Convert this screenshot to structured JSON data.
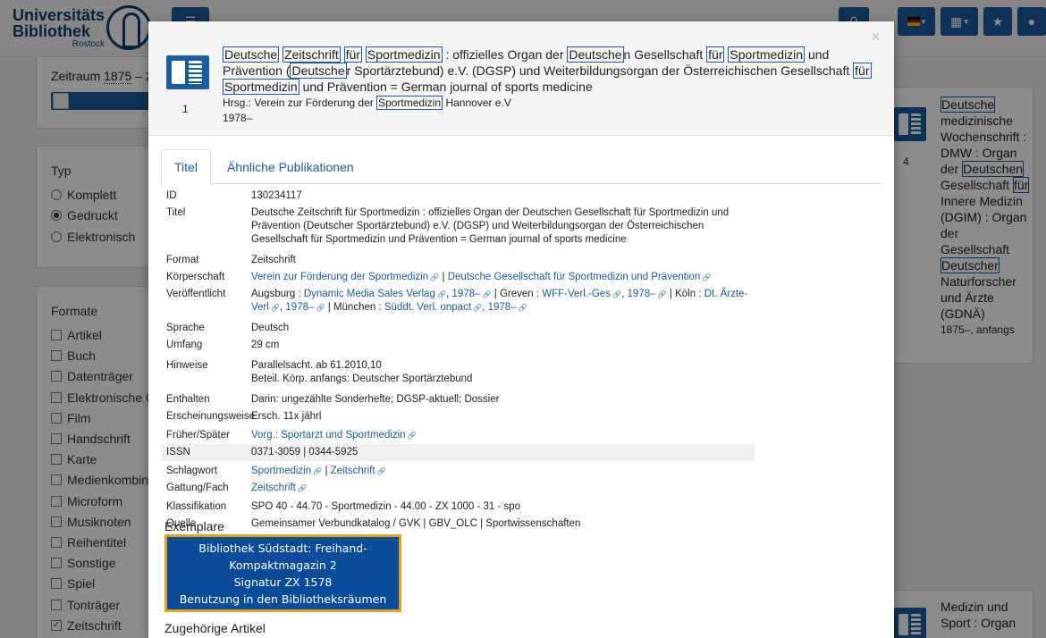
{
  "header": {
    "logo_line1": "Universitäts",
    "logo_line2": "Bibliothek",
    "logo_line3": "Rostock",
    "lang_flag": "de-flag-icon",
    "caret": "▾"
  },
  "sidebar": {
    "zeitraum_label": "Zeitraum",
    "zeitraum_from": "1875",
    "zeitraum_sep": " – 2",
    "typ_title": "Typ",
    "typ_options": [
      {
        "label": "Komplett",
        "checked": false
      },
      {
        "label": "Gedruckt",
        "checked": true
      },
      {
        "label": "Elektronisch",
        "checked": false
      }
    ],
    "formate_title": "Formate",
    "formate": [
      {
        "label": "Artikel",
        "checked": false
      },
      {
        "label": "Buch",
        "checked": false
      },
      {
        "label": "Datenträger",
        "checked": false
      },
      {
        "label": "Elektronische Q",
        "checked": false
      },
      {
        "label": "Film",
        "checked": false
      },
      {
        "label": "Handschrift",
        "checked": false
      },
      {
        "label": "Karte",
        "checked": false
      },
      {
        "label": "Medienkombin",
        "checked": false
      },
      {
        "label": "Microform",
        "checked": false
      },
      {
        "label": "Musiknoten",
        "checked": false
      },
      {
        "label": "Reihentitel",
        "checked": false
      },
      {
        "label": "Sonstige",
        "checked": false
      },
      {
        "label": "Spiel",
        "checked": false
      },
      {
        "label": "Tonträger",
        "checked": false
      },
      {
        "label": "Zeitschrift",
        "checked": true
      }
    ],
    "check_mark": "✓"
  },
  "right_results": {
    "item4": {
      "number": "4",
      "t1": "Deutsche",
      "t2": " medizinische Wochenschrift : DMW : Organ der ",
      "t3": "Deutschen",
      "t4": " Gesellschaft ",
      "t5": "für",
      "t6": " Innere Medizin (DGIM) : Organ der Gesellschaft ",
      "t7": "Deutscher",
      "t8": " Naturforscher und Ärzte (GDNÄ)",
      "year": "1875–, anfangs"
    },
    "item5": {
      "text": "Medizin und Sport : Organ"
    }
  },
  "modal": {
    "number": "1",
    "close": "×",
    "title_parts": [
      {
        "t": "Deutsche",
        "hl": true
      },
      {
        "t": " ",
        "hl": false
      },
      {
        "t": "Zeitschrift",
        "hl": true
      },
      {
        "t": " ",
        "hl": false
      },
      {
        "t": "für",
        "hl": true
      },
      {
        "t": " ",
        "hl": false
      },
      {
        "t": "Sportmedizin",
        "hl": true
      },
      {
        "t": " : offizielles Organ der ",
        "hl": false
      },
      {
        "t": "Deutsche",
        "hl": true
      },
      {
        "t": "n Gesellschaft ",
        "hl": false
      },
      {
        "t": "für",
        "hl": true
      },
      {
        "t": " ",
        "hl": false
      },
      {
        "t": "Sportmedizin",
        "hl": true
      },
      {
        "t": " und Prävention (",
        "hl": false
      },
      {
        "t": "Deutsche",
        "hl": true
      },
      {
        "t": "r Sportärztebund) e.V. (DGSP) und Weiterbildungsorgan der Österreichischen Gesellschaft ",
        "hl": false
      },
      {
        "t": "für",
        "hl": true
      },
      {
        "t": " ",
        "hl": false
      },
      {
        "t": "Sportmedizin",
        "hl": true
      },
      {
        "t": " und Prävention = German journal of sports medicine",
        "hl": false
      }
    ],
    "hrsg_prefix": "Hrsg.: Verein zur Förderung der ",
    "hrsg_hl": "Sportmedizin",
    "hrsg_suffix": " Hannover e.V",
    "year": "1978–",
    "tabs": [
      {
        "label": "Titel",
        "active": true
      },
      {
        "label": "Ähnliche Publikationen",
        "active": false
      }
    ],
    "details": {
      "id_label": "ID",
      "id": "130234117",
      "titel_label": "Titel",
      "titel": "Deutsche Zeitschrift für Sportmedizin : offizielles Organ der Deutschen Gesellschaft für Sportmedizin und Prävention (Deutscher Sportärztebund) e.V. (DGSP) und Weiterbildungsorgan der Österreichischen Gesellschaft für Sportmedizin und Prävention = German journal of sports medicine",
      "format_label": "Format",
      "format": "Zeitschrift",
      "koerperschaft_label": "Körperschaft",
      "koerperschaft_1": "Verein zur Förderung der Sportmedizin",
      "koerperschaft_2": "Deutsche Gesellschaft für Sportmedizin und Prävention",
      "veroeff_label": "Veröffentlicht",
      "v_augsburg": "Augsburg : ",
      "v_dms": "Dynamic Media Sales Verlag",
      "v_1978a": "1978–",
      "v_greven": " | Greven : ",
      "v_wff": "WFF-Verl.-Ges",
      "v_1978b": "1978–",
      "v_koeln": " | Köln : ",
      "v_dt": "Dt. Ärzte-Verl",
      "v_1978c": "1978–",
      "v_muenchen": " | München : ",
      "v_sued": "Süddt. Verl. onpact",
      "v_1978d": "1978–",
      "sprache_label": "Sprache",
      "sprache": "Deutsch",
      "umfang_label": "Umfang",
      "umfang": "29 cm",
      "hinweise_label": "Hinweise",
      "hinweise_1": "Parallelsacht. ab 61.2010,10",
      "hinweise_2": "Beteil. Körp. anfangs: Deutscher Sportärztebund",
      "enthalten_label": "Enthalten",
      "enthalten": "Darin: ungezählte Sonderhefte; DGSP-aktuell; Dossier",
      "erscheinung_label": "Erscheinungsweise",
      "erscheinung": "Ersch. 11x jährl",
      "frueher_label": "Früher/Später",
      "frueher": "Vorg.: Sportarzt und Sportmedizin",
      "issn_label": "ISSN",
      "issn": "0371-3059 | 0344-5925",
      "schlagwort_label": "Schlagwort",
      "schlagwort_1": "Sportmedizin",
      "schlagwort_2": "Zeitschrift",
      "gattung_label": "Gattung/Fach",
      "gattung": "Zeitschrift",
      "klass_label": "Klassifikation",
      "klass": "SPO 40 - 44.70 - Sportmedizin - 44.00 - ZX 1000 - 31 - spo",
      "quelle_label": "Quelle",
      "quelle": "Gemeinsamer Verbundkatalog / GVK | GBV_OLC | Sportwissenschaften"
    },
    "sep": " | ",
    "comma": ", ",
    "exemplare_title": "Exemplare",
    "exemplar": {
      "line1": "Bibliothek Südstadt: Freihand-",
      "line2": "Kompaktmagazin 2",
      "line3": "Signatur ZX 1578",
      "line4": "Benutzung in den Bibliotheksräumen"
    },
    "zugehoerige_title": "Zugehörige Artikel"
  },
  "colors": {
    "accent": "#1a5a9e",
    "exemplar_bg": "#0b4c9a",
    "exemplar_border": "#e3a21b"
  }
}
